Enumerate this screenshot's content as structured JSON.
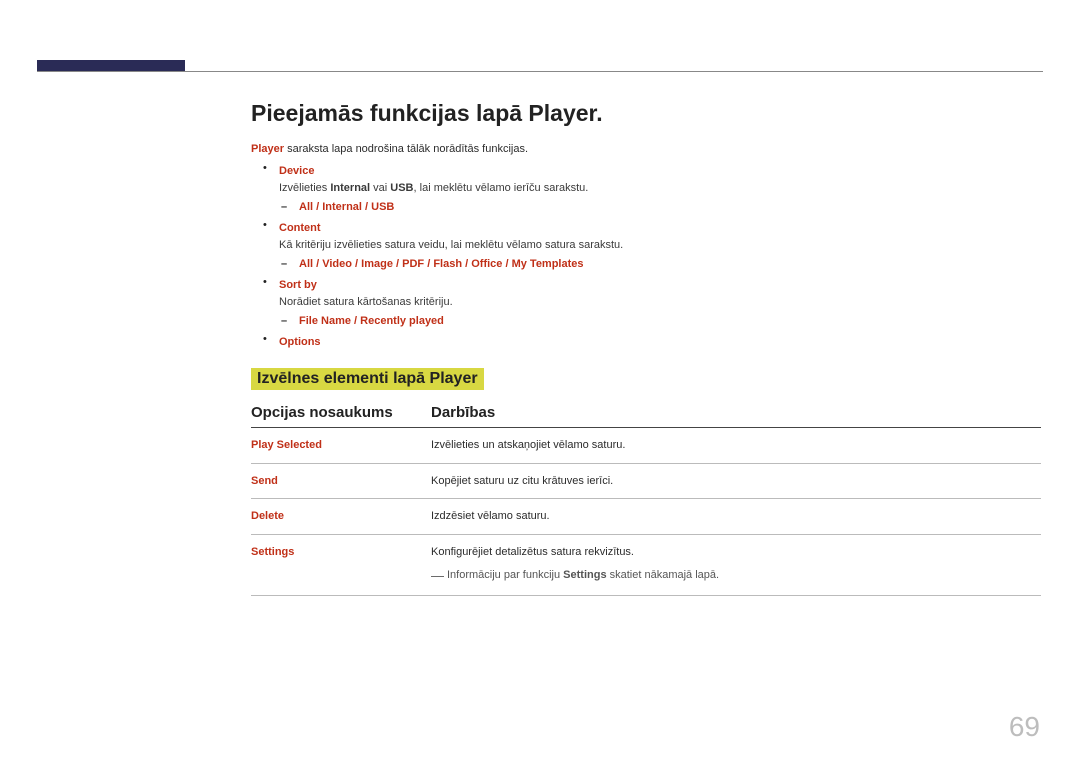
{
  "title": "Pieejamās funkcijas lapā Player.",
  "intro_prefix_bold": "Player",
  "intro_rest": " saraksta lapa nodrošina tālāk norādītās funkcijas.",
  "items": [
    {
      "head": "Device",
      "desc_pre": "Izvēlieties ",
      "desc_bold1": "Internal",
      "desc_mid": " vai ",
      "desc_bold2": "USB",
      "desc_post": ", lai meklētu vēlamo ierīču sarakstu.",
      "subs": [
        "All",
        "Internal",
        "USB"
      ]
    },
    {
      "head": "Content",
      "desc": "Kā kritēriju izvēlieties satura veidu, lai meklētu vēlamo satura sarakstu.",
      "subs": [
        "All",
        "Video",
        "Image",
        "PDF",
        "Flash",
        "Office",
        "My Templates"
      ]
    },
    {
      "head": "Sort by",
      "desc": "Norādiet satura kārtošanas kritēriju.",
      "subs": [
        "File Name",
        "Recently played"
      ]
    },
    {
      "head": "Options"
    }
  ],
  "section_heading": "Izvēlnes elementi lapā Player",
  "table_headers": {
    "name": "Opcijas nosaukums",
    "action": "Darbības"
  },
  "table_rows": [
    {
      "name": "Play Selected",
      "action": "Izvēlieties un atskaņojiet vēlamo saturu."
    },
    {
      "name": "Send",
      "action": "Kopējiet saturu uz citu krātuves ierīci."
    },
    {
      "name": "Delete",
      "action": "Izdzēsiet vēlamo saturu."
    },
    {
      "name": "Settings",
      "action": "Konfigurējiet detalizētus satura rekvizītus.",
      "note_pre": "Informāciju par funkciju ",
      "note_bold": "Settings",
      "note_post": " skatiet nākamajā lapā."
    }
  ],
  "page_number": "69"
}
